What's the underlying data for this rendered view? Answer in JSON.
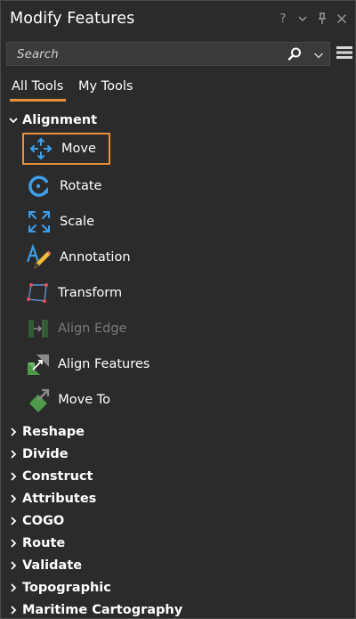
{
  "window": {
    "title": "Modify Features",
    "help_glyph": "?",
    "dropdown_glyph": "⌄",
    "pin_glyph": "†",
    "close_glyph": "✕"
  },
  "search": {
    "placeholder": "Search",
    "value": ""
  },
  "tabs": [
    {
      "label": "All Tools",
      "active": true
    },
    {
      "label": "My Tools",
      "active": false
    }
  ],
  "alignment_group": {
    "label": "Alignment",
    "expanded": true,
    "tools": [
      {
        "label": "Move",
        "icon": "move-icon",
        "selected": true,
        "enabled": true
      },
      {
        "label": "Rotate",
        "icon": "rotate-icon",
        "selected": false,
        "enabled": true
      },
      {
        "label": "Scale",
        "icon": "scale-icon",
        "selected": false,
        "enabled": true
      },
      {
        "label": "Annotation",
        "icon": "annotation-icon",
        "selected": false,
        "enabled": true
      },
      {
        "label": "Transform",
        "icon": "transform-icon",
        "selected": false,
        "enabled": true
      },
      {
        "label": "Align Edge",
        "icon": "align-edge-icon",
        "selected": false,
        "enabled": false
      },
      {
        "label": "Align Features",
        "icon": "align-features-icon",
        "selected": false,
        "enabled": true
      },
      {
        "label": "Move To",
        "icon": "move-to-icon",
        "selected": false,
        "enabled": true
      }
    ]
  },
  "collapsed_groups": [
    {
      "label": "Reshape"
    },
    {
      "label": "Divide"
    },
    {
      "label": "Construct"
    },
    {
      "label": "Attributes"
    },
    {
      "label": "COGO"
    },
    {
      "label": "Route"
    },
    {
      "label": "Validate"
    },
    {
      "label": "Topographic"
    },
    {
      "label": "Maritime Cartography"
    }
  ],
  "colors": {
    "background": "#2b2b2b",
    "accent_orange": "#e8913a",
    "icon_blue": "#3f9ee8",
    "icon_green": "#5fa05a",
    "disabled_text": "#7a7a7a"
  }
}
